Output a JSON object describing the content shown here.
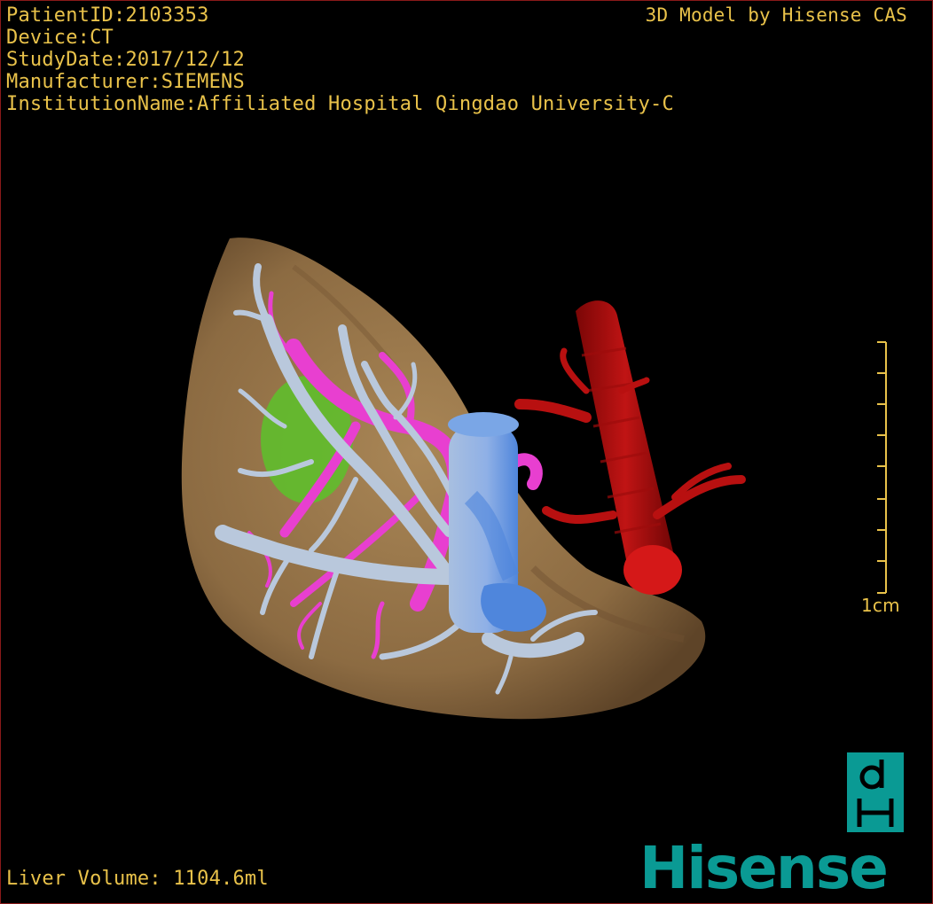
{
  "patient_info": {
    "patient_id": "PatientID:2103353",
    "device": "Device:CT",
    "study_date": "StudyDate:2017/12/12",
    "manufacturer": "Manufacturer:SIEMENS",
    "institution": "InstitutionName:Affiliated Hospital Qingdao University-C"
  },
  "credit": "3D Model by Hisense CAS",
  "liver_volume": "Liver Volume: 1104.6ml",
  "scale_bar": {
    "label": "1cm"
  },
  "logo": {
    "monogram_top": "d",
    "monogram_bottom": "H",
    "wordmark": "Hisense"
  },
  "colors": {
    "overlay_text": "#e9c24a",
    "liver": "#9c7a4e",
    "hepatic_vein": "#b9c8dc",
    "portal_vein": "#e83fd0",
    "lesion": "#5fbe2c",
    "ivc": "#6a9fe6",
    "artery": "#b81010",
    "brand": "#0a9a94"
  }
}
